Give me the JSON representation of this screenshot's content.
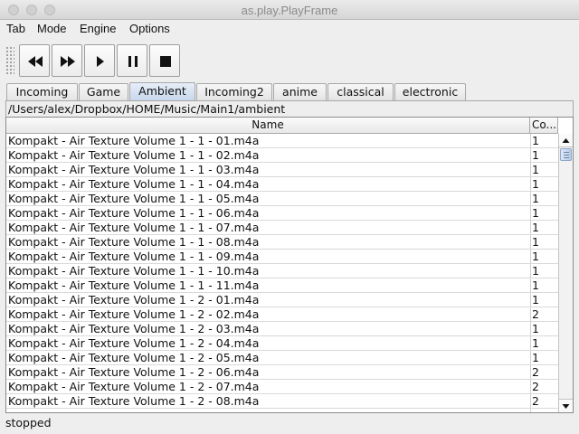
{
  "window": {
    "title": "as.play.PlayFrame"
  },
  "menubar": {
    "items": [
      {
        "label": "Tab"
      },
      {
        "label": "Mode"
      },
      {
        "label": "Engine"
      },
      {
        "label": "Options"
      }
    ]
  },
  "toolbar": {
    "buttons": [
      {
        "icon": "rewind-icon"
      },
      {
        "icon": "fast-forward-icon"
      },
      {
        "icon": "play-icon"
      },
      {
        "icon": "pause-icon"
      },
      {
        "icon": "stop-icon"
      }
    ]
  },
  "tabs": [
    {
      "label": "Incoming",
      "active": false
    },
    {
      "label": "Game",
      "active": false
    },
    {
      "label": "Ambient",
      "active": true
    },
    {
      "label": "Incoming2",
      "active": false
    },
    {
      "label": "anime",
      "active": false
    },
    {
      "label": "classical",
      "active": false
    },
    {
      "label": "electronic",
      "active": false
    }
  ],
  "path": "/Users/alex/Dropbox/HOME/Music/Main1/ambient",
  "table": {
    "columns": [
      "Name",
      "Co..."
    ],
    "rows": [
      {
        "name": "Kompakt - Air Texture Volume 1 - 1 - 01.m4a",
        "count": "1"
      },
      {
        "name": "Kompakt - Air Texture Volume 1 - 1 - 02.m4a",
        "count": "1"
      },
      {
        "name": "Kompakt - Air Texture Volume 1 - 1 - 03.m4a",
        "count": "1"
      },
      {
        "name": "Kompakt - Air Texture Volume 1 - 1 - 04.m4a",
        "count": "1"
      },
      {
        "name": "Kompakt - Air Texture Volume 1 - 1 - 05.m4a",
        "count": "1"
      },
      {
        "name": "Kompakt - Air Texture Volume 1 - 1 - 06.m4a",
        "count": "1"
      },
      {
        "name": "Kompakt - Air Texture Volume 1 - 1 - 07.m4a",
        "count": "1"
      },
      {
        "name": "Kompakt - Air Texture Volume 1 - 1 - 08.m4a",
        "count": "1"
      },
      {
        "name": "Kompakt - Air Texture Volume 1 - 1 - 09.m4a",
        "count": "1"
      },
      {
        "name": "Kompakt - Air Texture Volume 1 - 1 - 10.m4a",
        "count": "1"
      },
      {
        "name": "Kompakt - Air Texture Volume 1 - 1 - 11.m4a",
        "count": "1"
      },
      {
        "name": "Kompakt - Air Texture Volume 1 - 2 - 01.m4a",
        "count": "1"
      },
      {
        "name": "Kompakt - Air Texture Volume 1 - 2 - 02.m4a",
        "count": "2"
      },
      {
        "name": "Kompakt - Air Texture Volume 1 - 2 - 03.m4a",
        "count": "1"
      },
      {
        "name": "Kompakt - Air Texture Volume 1 - 2 - 04.m4a",
        "count": "1"
      },
      {
        "name": "Kompakt - Air Texture Volume 1 - 2 - 05.m4a",
        "count": "1"
      },
      {
        "name": "Kompakt - Air Texture Volume 1 - 2 - 06.m4a",
        "count": "2"
      },
      {
        "name": "Kompakt - Air Texture Volume 1 - 2 - 07.m4a",
        "count": "2"
      },
      {
        "name": "Kompakt - Air Texture Volume 1 - 2 - 08.m4a",
        "count": "2"
      }
    ]
  },
  "status": "stopped",
  "colors": {
    "active_tab": "#c9d7ec",
    "window_bg": "#eeeeee"
  }
}
